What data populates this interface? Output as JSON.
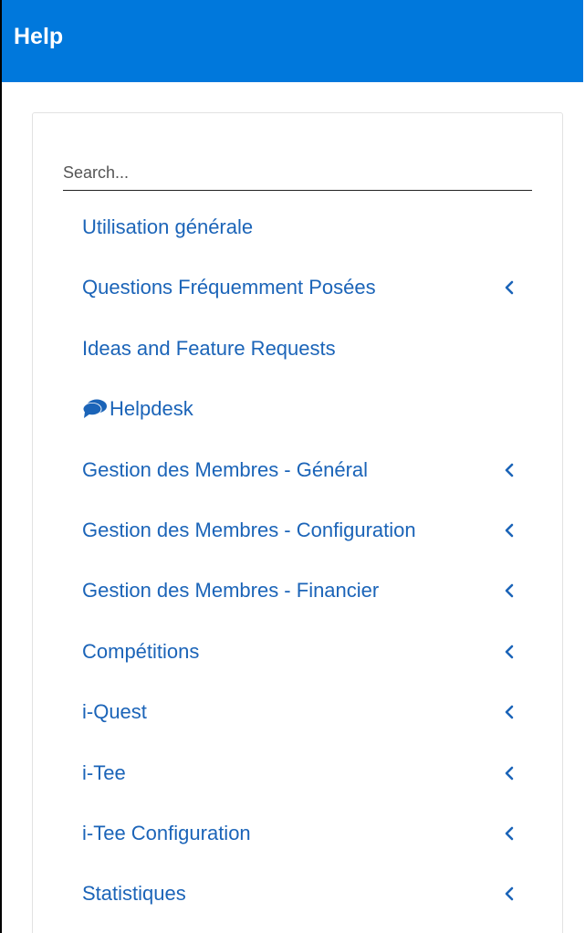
{
  "header": {
    "title": "Help"
  },
  "search": {
    "placeholder": "Search..."
  },
  "colors": {
    "header_bg": "#0078dc",
    "link": "#1b64b8"
  },
  "nav": {
    "items": [
      {
        "label": "Utilisation générale",
        "has_chevron": false,
        "icon": ""
      },
      {
        "label": "Questions Fréquemment Posées",
        "has_chevron": true,
        "icon": ""
      },
      {
        "label": "Ideas and Feature Requests",
        "has_chevron": false,
        "icon": ""
      },
      {
        "label": "Helpdesk",
        "has_chevron": false,
        "icon": "chat-bubbles-icon"
      },
      {
        "label": "Gestion des Membres - Général",
        "has_chevron": true,
        "icon": ""
      },
      {
        "label": "Gestion des Membres - Configuration",
        "has_chevron": true,
        "icon": ""
      },
      {
        "label": "Gestion des Membres - Financier",
        "has_chevron": true,
        "icon": ""
      },
      {
        "label": "Compétitions",
        "has_chevron": true,
        "icon": ""
      },
      {
        "label": "i-Quest",
        "has_chevron": true,
        "icon": ""
      },
      {
        "label": "i-Tee",
        "has_chevron": true,
        "icon": ""
      },
      {
        "label": "i-Tee Configuration",
        "has_chevron": true,
        "icon": ""
      },
      {
        "label": "Statistiques",
        "has_chevron": true,
        "icon": ""
      }
    ]
  }
}
